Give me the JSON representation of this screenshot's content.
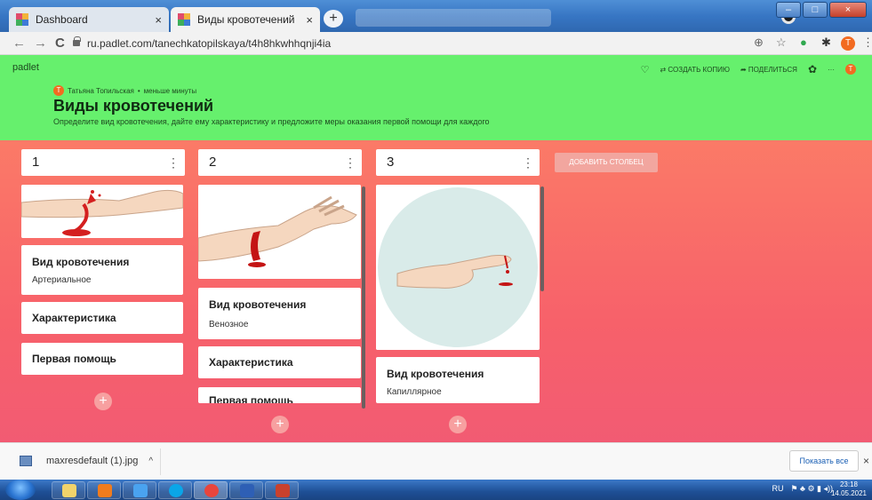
{
  "browser": {
    "tabs": [
      {
        "label": "Dashboard",
        "close": "×",
        "icon": "padlet-favicon"
      },
      {
        "label": "Виды кровотечений",
        "close": "×",
        "icon": "padlet-favicon"
      }
    ],
    "new_tab": "+",
    "url": "ru.padlet.com/tanechkatopilskaya/t4h8hkwhhqnji4ia",
    "nav": {
      "back": "←",
      "forward": "→",
      "reload": "C"
    },
    "window_controls": {
      "minimize": "–",
      "maximize": "□",
      "close": "×"
    }
  },
  "padlet": {
    "brand": "padlet",
    "actions": {
      "copy": "⇄ СОЗДАТЬ КОПИЮ",
      "share": "➦ ПОДЕЛИТЬСЯ",
      "more": "···",
      "user_initial": "Т"
    },
    "author": {
      "initial": "Т",
      "name": "Татьяна Топильская",
      "separator": "•",
      "time": "меньше минуты"
    },
    "title": "Виды кровотечений",
    "subtitle": "Определите вид кровотечения, дайте ему характеристику и предложите меры оказания первой помощи для каждого",
    "add_column": "ДОБАВИТЬ СТОЛБЕЦ",
    "columns": [
      {
        "title": "1",
        "menu": "⋮",
        "card_type": {
          "title": "Вид кровотечения",
          "text": "Артериальное"
        },
        "card_char": "Характеристика",
        "card_help": "Первая помощь",
        "add": "+"
      },
      {
        "title": "2",
        "menu": "⋮",
        "card_type": {
          "title": "Вид кровотечения",
          "text": "Венозное"
        },
        "card_char": "Характеристика",
        "card_help": "Первая помощь",
        "add": "+"
      },
      {
        "title": "3",
        "menu": "⋮",
        "card_type": {
          "title": "Вид кровотечения",
          "text": "Капиллярное"
        },
        "add": "+"
      }
    ]
  },
  "downloads": {
    "file": "maxresdefault (1).jpg",
    "chevron": "^",
    "show_all": "Показать все",
    "close": "×"
  },
  "taskbar": {
    "lang": "RU",
    "time": "23:18",
    "date": "14.05.2021"
  },
  "colors": {
    "header_green": "#66f06d",
    "board_top": "#fb7a67",
    "board_bottom": "#f25b73",
    "avatar_orange": "#f26b21"
  }
}
